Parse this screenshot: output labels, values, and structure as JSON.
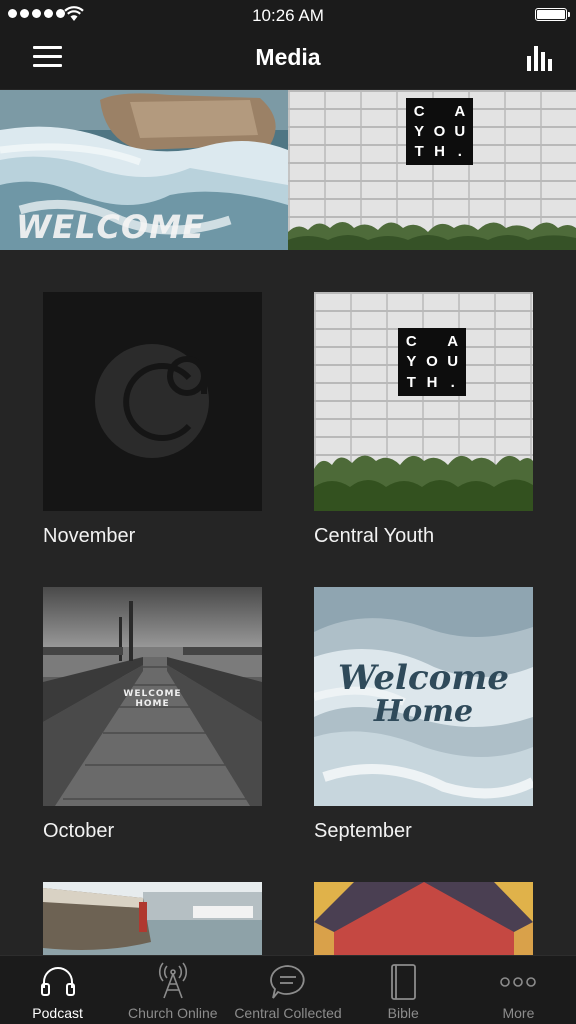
{
  "status_bar": {
    "time": "10:26 AM"
  },
  "nav": {
    "title": "Media"
  },
  "hero": {
    "left_caption": "WELCOME",
    "logo_letters": [
      "C",
      "",
      "A",
      "Y",
      "O",
      "U",
      "T",
      "H",
      "."
    ]
  },
  "grid": [
    {
      "label": "November"
    },
    {
      "label": "Central Youth"
    },
    {
      "label": "October"
    },
    {
      "label": "September"
    }
  ],
  "artwork_text": {
    "october_caption": [
      "WELCOME",
      "HOME"
    ],
    "september_caption": [
      "Welcome",
      "Home"
    ]
  },
  "tab_bar": {
    "items": [
      {
        "label": "Podcast",
        "icon": "headphones-icon",
        "active": true
      },
      {
        "label": "Church Online",
        "icon": "broadcast-tower-icon",
        "active": false
      },
      {
        "label": "Central Collected",
        "icon": "chat-bubble-icon",
        "active": false
      },
      {
        "label": "Bible",
        "icon": "book-icon",
        "active": false
      },
      {
        "label": "More",
        "icon": "more-dots-icon",
        "active": false
      }
    ]
  },
  "colors": {
    "background": "#252525",
    "bar": "#1b1b1b",
    "inactive_tab": "#8c8c8c"
  }
}
